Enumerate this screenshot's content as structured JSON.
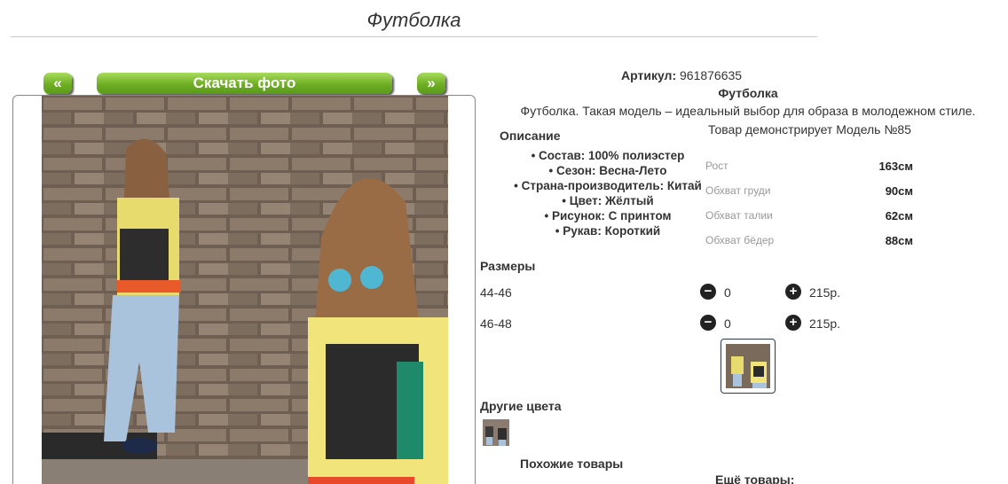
{
  "page": {
    "title": "Футболка"
  },
  "gallery": {
    "prev_label": "«",
    "next_label": "»",
    "download_label": "Скачать фото"
  },
  "product": {
    "article_label": "Артикул:",
    "article_value": "961876635",
    "name": "Футболка",
    "tagline": "Футболка. Такая модель – идеальный выбор для образа в молодежном стиле.",
    "model_note": "Товар демонстрирует Модель №85"
  },
  "description": {
    "title": "Описание",
    "items": [
      "Состав: 100% полиэстер",
      "Сезон: Весна-Лето",
      "Страна-производитель: Китай",
      "Цвет: Жёлтый",
      "Рисунок: С принтом",
      "Рукав: Короткий"
    ]
  },
  "measurements": [
    {
      "label": "Рост",
      "value": "163см"
    },
    {
      "label": "Обхват груди",
      "value": "90см"
    },
    {
      "label": "Обхват талии",
      "value": "62см"
    },
    {
      "label": "Обхват бёдер",
      "value": "88см"
    }
  ],
  "sizes": {
    "title": "Размеры",
    "rows": [
      {
        "size": "44-46",
        "minus": "−",
        "qty": "0",
        "plus": "+",
        "price": "215р."
      },
      {
        "size": "46-48",
        "minus": "−",
        "qty": "0",
        "plus": "+",
        "price": "215р."
      }
    ]
  },
  "other_colors": {
    "title": "Другие цвета"
  },
  "similar": {
    "title": "Похожие товары"
  },
  "more": {
    "title": "Ещё товары:"
  },
  "colors": {
    "brand_green": "#6fae24",
    "shirt_yellow": "#f2e47a",
    "jeans_blue": "#9fbcd6",
    "wall": "#7a6a5c"
  }
}
